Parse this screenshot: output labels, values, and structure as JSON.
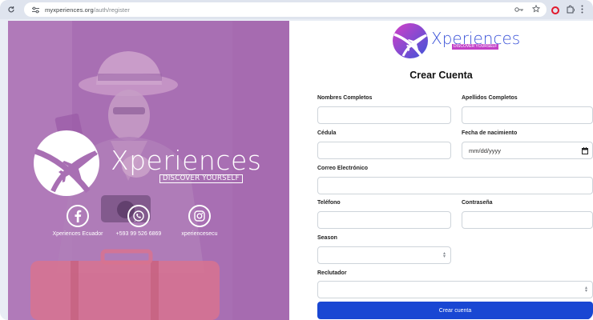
{
  "browser": {
    "url_domain": "myxperiences.org",
    "url_path": "/auth/register",
    "icons": [
      "reload-icon",
      "site-settings-icon",
      "password-key-icon",
      "star-icon",
      "opera-icon",
      "extensions-icon",
      "more-icon"
    ]
  },
  "hero": {
    "brand": "Xperiences",
    "tagline": "DISCOVER YOURSELF",
    "social": [
      {
        "icon": "facebook-icon",
        "label": "Xperiences Ecuador"
      },
      {
        "icon": "whatsapp-icon",
        "label": "+593 99 526 6869"
      },
      {
        "icon": "instagram-icon",
        "label": "xperiencesecu"
      }
    ]
  },
  "form": {
    "logo_text": "Xperiences",
    "logo_tagline": "DISCOVER YOURSELF",
    "title": "Crear Cuenta",
    "labels": {
      "nombres": "Nombres Completos",
      "apellidos": "Apellidos Completos",
      "cedula": "Cédula",
      "fecha": "Fecha de nacimiento",
      "correo": "Correo Electrónico",
      "telefono": "Teléfono",
      "contrasena": "Contraseña",
      "season": "Season",
      "reclutador": "Reclutador"
    },
    "values": {
      "nombres": "",
      "apellidos": "",
      "cedula": "",
      "fecha": "mm/dd/yyyy",
      "correo": "",
      "telefono": "",
      "contrasena": "",
      "season": "",
      "reclutador": ""
    },
    "submit_label": "Crear cuenta"
  },
  "colors": {
    "hero_overlay": "#a86fb3",
    "logo_blue": "#3d55d9",
    "logo_magenta": "#c241c7",
    "submit_blue": "#1947d3"
  }
}
